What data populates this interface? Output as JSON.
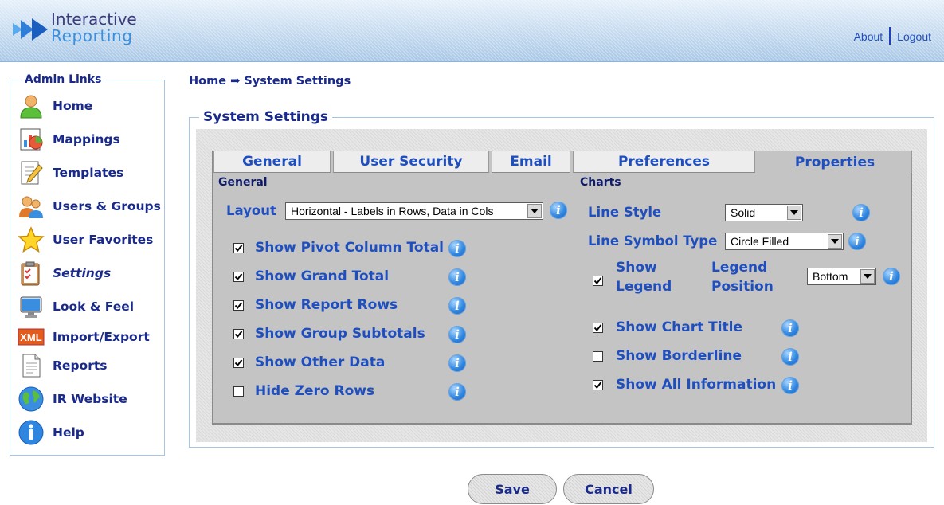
{
  "header": {
    "logo_line1": "Interactive",
    "logo_line2": "Reporting",
    "about": "About",
    "logout": "Logout"
  },
  "admin": {
    "legend": "Admin Links",
    "items": [
      {
        "label": "Home",
        "icon": "user-icon"
      },
      {
        "label": "Mappings",
        "icon": "chart-icon"
      },
      {
        "label": "Templates",
        "icon": "document-pencil-icon"
      },
      {
        "label": "Users & Groups",
        "icon": "users-icon"
      },
      {
        "label": "User Favorites",
        "icon": "star-icon"
      },
      {
        "label": "Settings",
        "icon": "clipboard-icon"
      },
      {
        "label": "Look & Feel",
        "icon": "monitor-icon"
      },
      {
        "label": "Import/Export",
        "icon": "xml-icon"
      },
      {
        "label": "Reports",
        "icon": "report-icon"
      },
      {
        "label": "IR Website",
        "icon": "globe-icon"
      },
      {
        "label": "Help",
        "icon": "info-icon"
      }
    ]
  },
  "breadcrumb": {
    "home": "Home",
    "arrow": "➡",
    "current": "System Settings"
  },
  "panel": {
    "legend": "System Settings",
    "tabs": [
      "General",
      "User Security",
      "Email",
      "Preferences",
      "Properties"
    ],
    "active_tab": "Properties",
    "general": {
      "heading": "General",
      "layout_label": "Layout",
      "layout_value": "Horizontal - Labels in Rows, Data in Cols",
      "options": [
        {
          "label": "Show Pivot Column Total",
          "checked": true
        },
        {
          "label": "Show Grand Total",
          "checked": true
        },
        {
          "label": "Show Report Rows",
          "checked": true
        },
        {
          "label": "Show Group Subtotals",
          "checked": true
        },
        {
          "label": "Show Other Data",
          "checked": true
        },
        {
          "label": "Hide Zero Rows",
          "checked": false
        }
      ]
    },
    "charts": {
      "heading": "Charts",
      "line_style_label": "Line Style",
      "line_style_value": "Solid",
      "line_symbol_label": "Line Symbol Type",
      "line_symbol_value": "Circle Filled",
      "show_legend_line1": "Show",
      "show_legend_line2": "Legend",
      "show_legend_checked": true,
      "legend_position_line1": "Legend",
      "legend_position_line2": "Position",
      "legend_position_value": "Bottom",
      "options": [
        {
          "label": "Show Chart Title",
          "checked": true
        },
        {
          "label": "Show Borderline",
          "checked": false
        },
        {
          "label": "Show All Information",
          "checked": true
        }
      ]
    }
  },
  "buttons": {
    "save": "Save",
    "cancel": "Cancel"
  }
}
